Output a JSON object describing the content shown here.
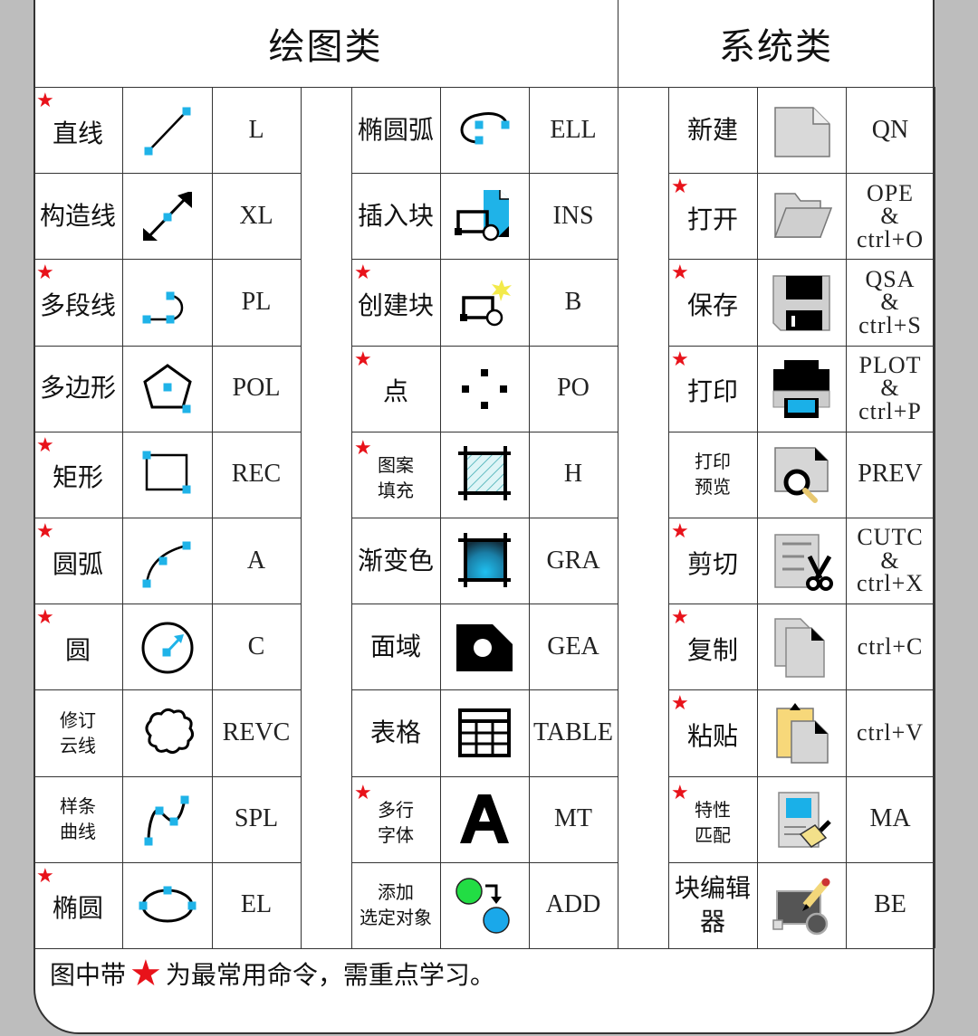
{
  "sections": {
    "drawing_title": "绘图类",
    "system_title": "系统类"
  },
  "colors": {
    "star": "#e8121a",
    "grip": "#1fb3e8",
    "background": "#bdbdbd"
  },
  "drawing_col1": [
    {
      "name": "直线",
      "icon": "line-icon",
      "command": "L",
      "starred": true
    },
    {
      "name": "构造线",
      "icon": "construction-line-icon",
      "command": "XL",
      "starred": false
    },
    {
      "name": "多段线",
      "icon": "polyline-icon",
      "command": "PL",
      "starred": true
    },
    {
      "name": "多边形",
      "icon": "polygon-icon",
      "command": "POL",
      "starred": false
    },
    {
      "name": "矩形",
      "icon": "rectangle-icon",
      "command": "REC",
      "starred": true
    },
    {
      "name": "圆弧",
      "icon": "arc-icon",
      "command": "A",
      "starred": true
    },
    {
      "name": "圆",
      "icon": "circle-icon",
      "command": "C",
      "starred": true
    },
    {
      "name": "修订\n云线",
      "icon": "revision-cloud-icon",
      "command": "REVC",
      "starred": false
    },
    {
      "name": "样条\n曲线",
      "icon": "spline-icon",
      "command": "SPL",
      "starred": false
    },
    {
      "name": "椭圆",
      "icon": "ellipse-icon",
      "command": "EL",
      "starred": true
    }
  ],
  "drawing_col2": [
    {
      "name": "椭圆弧",
      "icon": "elliptical-arc-icon",
      "command": "ELL",
      "starred": false
    },
    {
      "name": "插入块",
      "icon": "insert-block-icon",
      "command": "INS",
      "starred": false
    },
    {
      "name": "创建块",
      "icon": "create-block-icon",
      "command": "B",
      "starred": true
    },
    {
      "name": "点",
      "icon": "point-icon",
      "command": "PO",
      "starred": true
    },
    {
      "name": "图案\n填充",
      "icon": "hatch-icon",
      "command": "H",
      "starred": true
    },
    {
      "name": "渐变色",
      "icon": "gradient-icon",
      "command": "GRA",
      "starred": false
    },
    {
      "name": "面域",
      "icon": "region-icon",
      "command": "GEA",
      "starred": false
    },
    {
      "name": "表格",
      "icon": "table-icon",
      "command": "TABLE",
      "starred": false
    },
    {
      "name": "多行\n字体",
      "icon": "multiline-text-icon",
      "command": "MT",
      "starred": true
    },
    {
      "name": "添加\n选定对象",
      "icon": "add-selected-icon",
      "command": "ADD",
      "starred": false
    }
  ],
  "system_col": [
    {
      "name": "新建",
      "icon": "new-file-icon",
      "command": "QN",
      "starred": false
    },
    {
      "name": "打开",
      "icon": "open-folder-icon",
      "command": "OPE\n&\nctrl+O",
      "starred": true
    },
    {
      "name": "保存",
      "icon": "save-floppy-icon",
      "command": "QSA\n&\nctrl+S",
      "starred": true
    },
    {
      "name": "打印",
      "icon": "printer-icon",
      "command": "PLOT\n&\nctrl+P",
      "starred": true
    },
    {
      "name": "打印\n预览",
      "icon": "print-preview-icon",
      "command": "PREV",
      "starred": false
    },
    {
      "name": "剪切",
      "icon": "cut-scissors-icon",
      "command": "CUTC\n&\nctrl+X",
      "starred": true
    },
    {
      "name": "复制",
      "icon": "copy-icon",
      "command": "ctrl+C",
      "starred": true
    },
    {
      "name": "粘贴",
      "icon": "paste-icon",
      "command": "ctrl+V",
      "starred": true
    },
    {
      "name": "特性\n匹配",
      "icon": "match-properties-icon",
      "command": "MA",
      "starred": true
    },
    {
      "name": "块编辑器",
      "icon": "block-editor-icon",
      "command": "BE",
      "starred": false
    }
  ],
  "footer": {
    "prefix": "图中带",
    "suffix": "为最常用命令，需重点学习。"
  }
}
